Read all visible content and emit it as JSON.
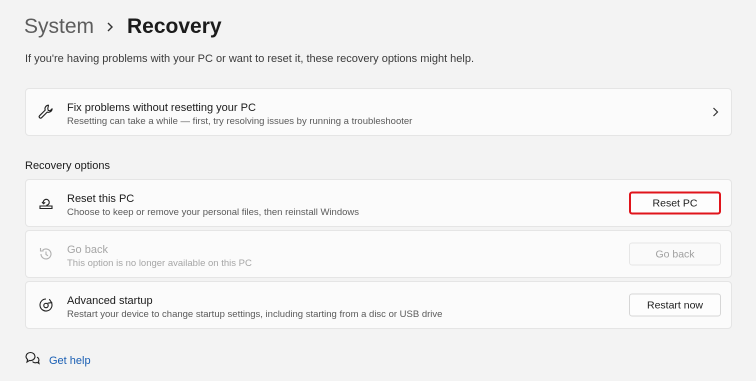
{
  "breadcrumb": {
    "parent": "System",
    "current": "Recovery"
  },
  "subtitle": "If you're having problems with your PC or want to reset it, these recovery options might help.",
  "fix_card": {
    "title": "Fix problems without resetting your PC",
    "description": "Resetting can take a while — first, try resolving issues by running a troubleshooter",
    "icon": "wrench-icon"
  },
  "recovery_section": {
    "title": "Recovery options",
    "items": [
      {
        "title": "Reset this PC",
        "description": "Choose to keep or remove your personal files, then reinstall Windows",
        "button": "Reset PC",
        "icon": "reset-pc-icon",
        "enabled": true,
        "highlighted": true
      },
      {
        "title": "Go back",
        "description": "This option is no longer available on this PC",
        "button": "Go back",
        "icon": "go-back-icon",
        "enabled": false,
        "highlighted": false
      },
      {
        "title": "Advanced startup",
        "description": "Restart your device to change startup settings, including starting from a disc or USB drive",
        "button": "Restart now",
        "icon": "advanced-startup-icon",
        "enabled": true,
        "highlighted": false
      }
    ]
  },
  "help": {
    "label": "Get help",
    "icon": "help-icon"
  },
  "colors": {
    "background": "#f3f3f3",
    "card": "#fbfbfb",
    "highlight_border": "#e0141b",
    "link": "#1a5fb4"
  }
}
